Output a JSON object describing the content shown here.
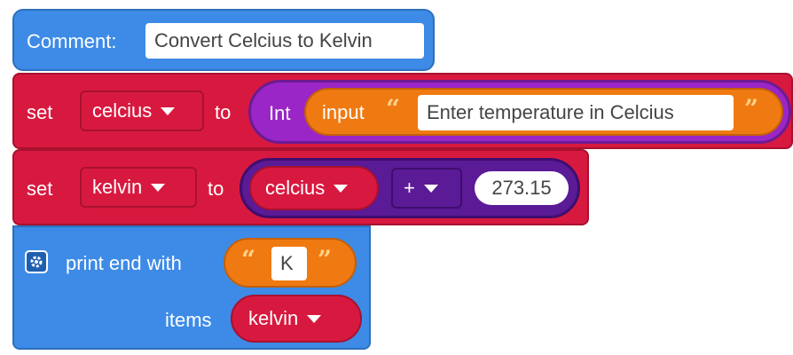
{
  "comment_block": {
    "label": "Comment:",
    "value": "Convert Celcius to Kelvin"
  },
  "set_celcius": {
    "set_label": "set",
    "variable": "celcius",
    "to_label": "to",
    "int_label": "Int",
    "input_label": "input",
    "open_quote": "“",
    "prompt_text": "Enter temperature in Celcius",
    "close_quote": "”"
  },
  "set_kelvin": {
    "set_label": "set",
    "variable": "kelvin",
    "to_label": "to",
    "operand_variable": "celcius",
    "operator": "+",
    "number": "273.15"
  },
  "print_block": {
    "label": "print end with",
    "open_quote": "“",
    "end_text": "K",
    "close_quote": "”",
    "items_label": "items",
    "items_variable": "kelvin"
  },
  "colors": {
    "blue": "#3d8be6",
    "red": "#d8193f",
    "purple": "#7b22a8",
    "orange": "#ef7a12"
  },
  "icons": [
    "gear-icon",
    "dropdown-caret-icon"
  ]
}
